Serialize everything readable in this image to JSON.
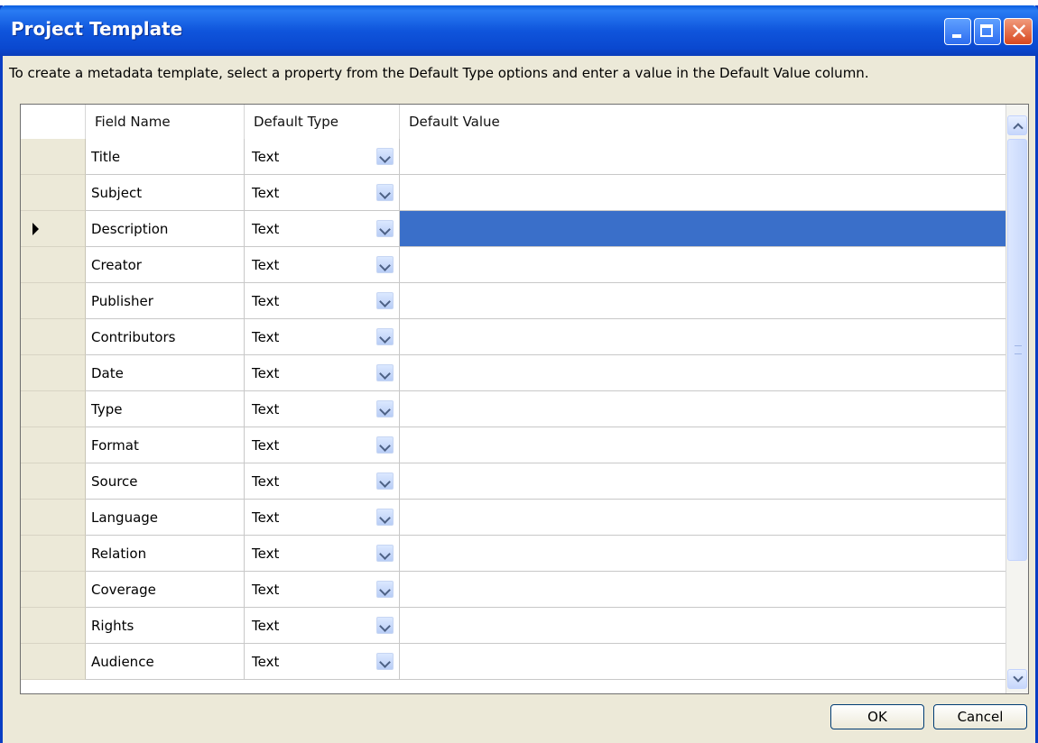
{
  "window": {
    "title": "Project Template"
  },
  "instructions": "To create a metadata template, select a property from the Default Type options and enter a value in the Default Value column.",
  "grid": {
    "columns": [
      "Field Name",
      "Default Type",
      "Default Value"
    ],
    "selected_row_index": 2,
    "rows": [
      {
        "field": "Title",
        "type": "Text",
        "value": ""
      },
      {
        "field": "Subject",
        "type": "Text",
        "value": ""
      },
      {
        "field": "Description",
        "type": "Text",
        "value": ""
      },
      {
        "field": "Creator",
        "type": "Text",
        "value": ""
      },
      {
        "field": "Publisher",
        "type": "Text",
        "value": ""
      },
      {
        "field": "Contributors",
        "type": "Text",
        "value": ""
      },
      {
        "field": "Date",
        "type": "Text",
        "value": ""
      },
      {
        "field": "Type",
        "type": "Text",
        "value": ""
      },
      {
        "field": "Format",
        "type": "Text",
        "value": ""
      },
      {
        "field": "Source",
        "type": "Text",
        "value": ""
      },
      {
        "field": "Language",
        "type": "Text",
        "value": ""
      },
      {
        "field": "Relation",
        "type": "Text",
        "value": ""
      },
      {
        "field": "Coverage",
        "type": "Text",
        "value": ""
      },
      {
        "field": "Rights",
        "type": "Text",
        "value": ""
      },
      {
        "field": "Audience",
        "type": "Text",
        "value": ""
      }
    ]
  },
  "buttons": {
    "ok": "OK",
    "cancel": "Cancel"
  },
  "colors": {
    "titlebar": "#0a5ee0",
    "selection": "#3a6fc9"
  }
}
